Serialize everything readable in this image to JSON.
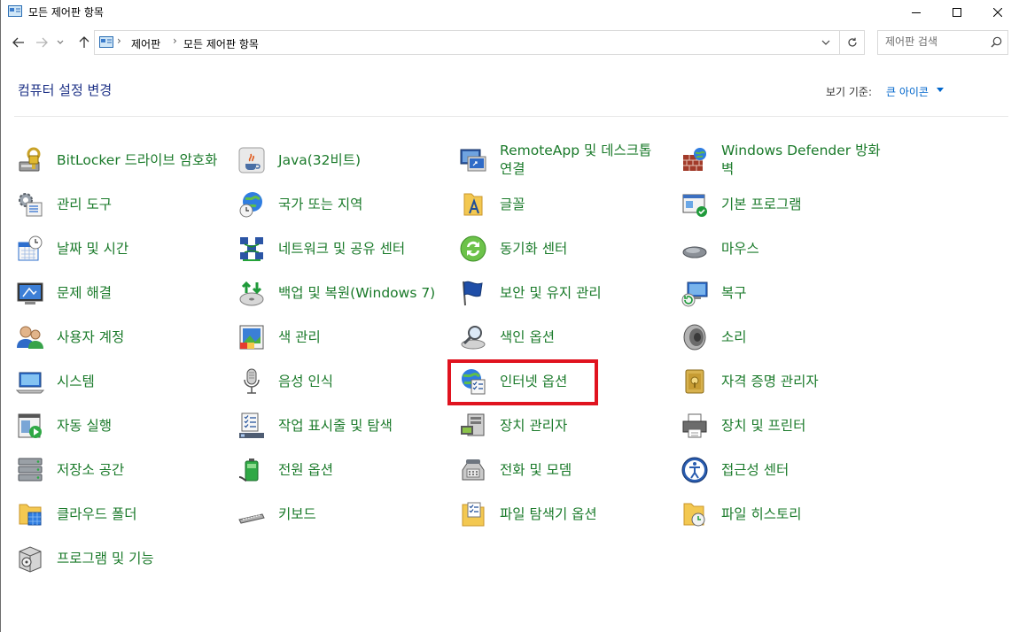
{
  "window": {
    "title": "모든 제어판 항목",
    "buttons": [
      "minimize",
      "maximize",
      "close"
    ]
  },
  "address": {
    "breadcrumbs": [
      "제어판",
      "모든 제어판 항목"
    ],
    "search_placeholder": "제어판 검색"
  },
  "header": {
    "title": "컴퓨터 설정 변경",
    "view_by_label": "보기 기준:",
    "view_by_value": "큰 아이콘"
  },
  "items": [
    {
      "label": "BitLocker 드라이브 암호화",
      "icon": "bitlocker-icon"
    },
    {
      "label": "Java(32비트)",
      "icon": "java-icon"
    },
    {
      "label": "RemoteApp 및 데스크톱 연결",
      "icon": "remoteapp-icon"
    },
    {
      "label": "Windows Defender 방화벽",
      "icon": "firewall-icon"
    },
    {
      "label": "관리 도구",
      "icon": "admin-tools-icon"
    },
    {
      "label": "국가 또는 지역",
      "icon": "region-icon"
    },
    {
      "label": "글꼴",
      "icon": "fonts-icon"
    },
    {
      "label": "기본 프로그램",
      "icon": "default-programs-icon"
    },
    {
      "label": "날짜 및 시간",
      "icon": "date-time-icon"
    },
    {
      "label": "네트워크 및 공유 센터",
      "icon": "network-icon"
    },
    {
      "label": "동기화 센터",
      "icon": "sync-icon"
    },
    {
      "label": "마우스",
      "icon": "mouse-icon"
    },
    {
      "label": "문제 해결",
      "icon": "troubleshoot-icon"
    },
    {
      "label": "백업 및 복원(Windows 7)",
      "icon": "backup-icon"
    },
    {
      "label": "보안 및 유지 관리",
      "icon": "security-flag-icon"
    },
    {
      "label": "복구",
      "icon": "recovery-icon"
    },
    {
      "label": "사용자 계정",
      "icon": "user-accounts-icon"
    },
    {
      "label": "색 관리",
      "icon": "color-management-icon"
    },
    {
      "label": "색인 옵션",
      "icon": "indexing-icon"
    },
    {
      "label": "소리",
      "icon": "sound-icon"
    },
    {
      "label": "시스템",
      "icon": "system-icon"
    },
    {
      "label": "음성 인식",
      "icon": "microphone-icon"
    },
    {
      "label": "인터넷 옵션",
      "icon": "internet-options-icon"
    },
    {
      "label": "자격 증명 관리자",
      "icon": "credential-icon"
    },
    {
      "label": "자동 실행",
      "icon": "autoplay-icon"
    },
    {
      "label": "작업 표시줄 및 탐색",
      "icon": "taskbar-icon"
    },
    {
      "label": "장치 관리자",
      "icon": "device-manager-icon"
    },
    {
      "label": "장치 및 프린터",
      "icon": "printer-icon"
    },
    {
      "label": "저장소 공간",
      "icon": "storage-icon"
    },
    {
      "label": "전원 옵션",
      "icon": "battery-icon"
    },
    {
      "label": "전화 및 모뎀",
      "icon": "phone-icon"
    },
    {
      "label": "접근성 센터",
      "icon": "accessibility-icon"
    },
    {
      "label": "클라우드 폴더",
      "icon": "cloud-folder-icon"
    },
    {
      "label": "키보드",
      "icon": "keyboard-icon"
    },
    {
      "label": "파일 탐색기 옵션",
      "icon": "folder-options-icon"
    },
    {
      "label": "파일 히스토리",
      "icon": "file-history-icon"
    },
    {
      "label": "프로그램 및 기능",
      "icon": "programs-icon"
    }
  ],
  "highlighted_item": "인터넷 옵션",
  "colors": {
    "title": "#1e3287",
    "link_blue": "#1f3a93",
    "link_green": "#1a7a2a",
    "highlight": "#e0131f"
  }
}
